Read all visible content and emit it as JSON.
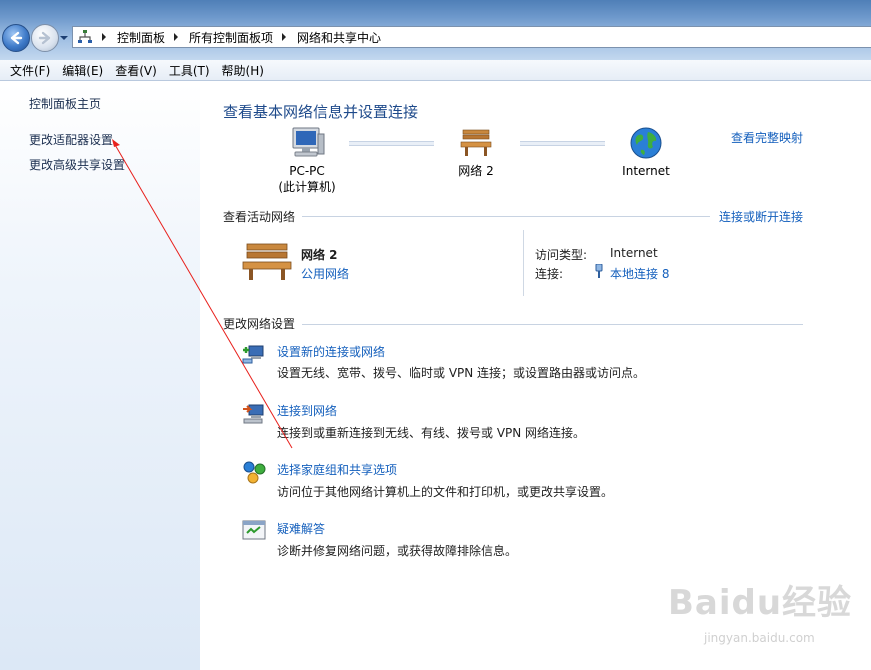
{
  "address_bar": {
    "breadcrumbs": [
      "控制面板",
      "所有控制面板项",
      "网络和共享中心"
    ]
  },
  "menu": [
    "文件(F)",
    "编辑(E)",
    "查看(V)",
    "工具(T)",
    "帮助(H)"
  ],
  "sidebar": {
    "items": [
      {
        "label": "控制面板主页"
      },
      {
        "label": "更改适配器设置"
      },
      {
        "label": "更改高级共享设置"
      }
    ]
  },
  "main": {
    "title": "查看基本网络信息并设置连接",
    "full_map_link": "查看完整映射",
    "map": {
      "computer_name": "PC-PC",
      "computer_sub": "(此计算机)",
      "network": "网络  2",
      "internet": "Internet"
    },
    "active_networks": {
      "heading": "查看活动网络",
      "connect_link": "连接或断开连接",
      "network_name": "网络  2",
      "network_type": "公用网络",
      "access_type_label": "访问类型:",
      "access_type_value": "Internet",
      "connection_label": "连接:",
      "connection_value": "本地连接 8"
    },
    "change_settings": {
      "heading": "更改网络设置",
      "tasks": [
        {
          "title": "设置新的连接或网络",
          "desc": "设置无线、宽带、拨号、临时或 VPN 连接；或设置路由器或访问点。",
          "icon": "new-connection-icon"
        },
        {
          "title": "连接到网络",
          "desc": "连接到或重新连接到无线、有线、拨号或 VPN 网络连接。",
          "icon": "connect-network-icon"
        },
        {
          "title": "选择家庭组和共享选项",
          "desc": "访问位于其他网络计算机上的文件和打印机，或更改共享设置。",
          "icon": "homegroup-icon"
        },
        {
          "title": "疑难解答",
          "desc": "诊断并修复网络问题，或获得故障排除信息。",
          "icon": "troubleshoot-icon"
        }
      ]
    }
  },
  "watermark": {
    "brand": "Baidu经验",
    "url": "jingyan.baidu.com"
  },
  "colors": {
    "link": "#1560bd",
    "title": "#1e4a8b",
    "annotation_arrow": "#e8201c"
  }
}
